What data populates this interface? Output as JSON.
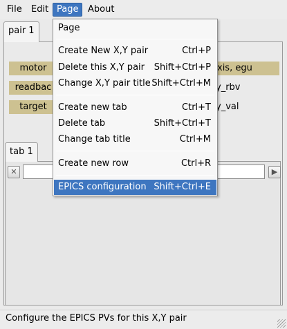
{
  "menubar": {
    "items": [
      {
        "label": "File"
      },
      {
        "label": "Edit"
      },
      {
        "label": "Page"
      },
      {
        "label": "About"
      }
    ]
  },
  "top_tab": {
    "label": "pair 1"
  },
  "rows": [
    {
      "label": "motor",
      "right": "xis, egu"
    },
    {
      "label": "readbac",
      "right": "y_rbv"
    },
    {
      "label": "target",
      "right": "y_val"
    }
  ],
  "inner_tab": {
    "label": "tab 1"
  },
  "row_input": {
    "value": ""
  },
  "dropdown": {
    "header": "Page",
    "items": [
      {
        "label": "Create New X,Y pair",
        "shortcut": "Ctrl+P"
      },
      {
        "label": "Delete this X,Y pair",
        "shortcut": "Shift+Ctrl+P"
      },
      {
        "label": "Change X,Y pair title",
        "shortcut": "Shift+Ctrl+M"
      },
      {
        "label": "Create new tab",
        "shortcut": "Ctrl+T"
      },
      {
        "label": "Delete tab",
        "shortcut": "Shift+Ctrl+T"
      },
      {
        "label": "Change tab title",
        "shortcut": "Ctrl+M"
      },
      {
        "label": "Create new row",
        "shortcut": "Ctrl+R"
      },
      {
        "label": "EPICS configuration",
        "shortcut": "Shift+Ctrl+E"
      }
    ]
  },
  "statusbar": {
    "text": "Configure the EPICS PVs for this X,Y pair"
  },
  "colors": {
    "accent": "#3e76c0",
    "label_bg": "#cdc191"
  }
}
